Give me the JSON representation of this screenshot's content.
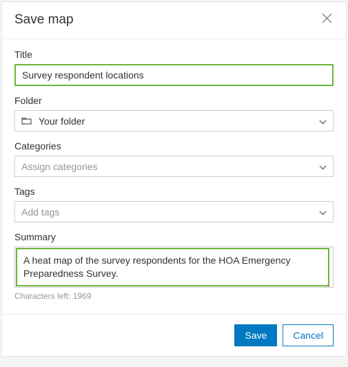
{
  "dialog": {
    "title": "Save map"
  },
  "fields": {
    "title": {
      "label": "Title",
      "value": "Survey respondent locations"
    },
    "folder": {
      "label": "Folder",
      "selected": "Your folder"
    },
    "categories": {
      "label": "Categories",
      "placeholder": "Assign categories"
    },
    "tags": {
      "label": "Tags",
      "placeholder": "Add tags"
    },
    "summary": {
      "label": "Summary",
      "value": "A heat map of the survey respondents for the HOA Emergency Preparedness Survey.",
      "chars_left_label": "Characters left: 1969"
    }
  },
  "buttons": {
    "save": "Save",
    "cancel": "Cancel"
  }
}
